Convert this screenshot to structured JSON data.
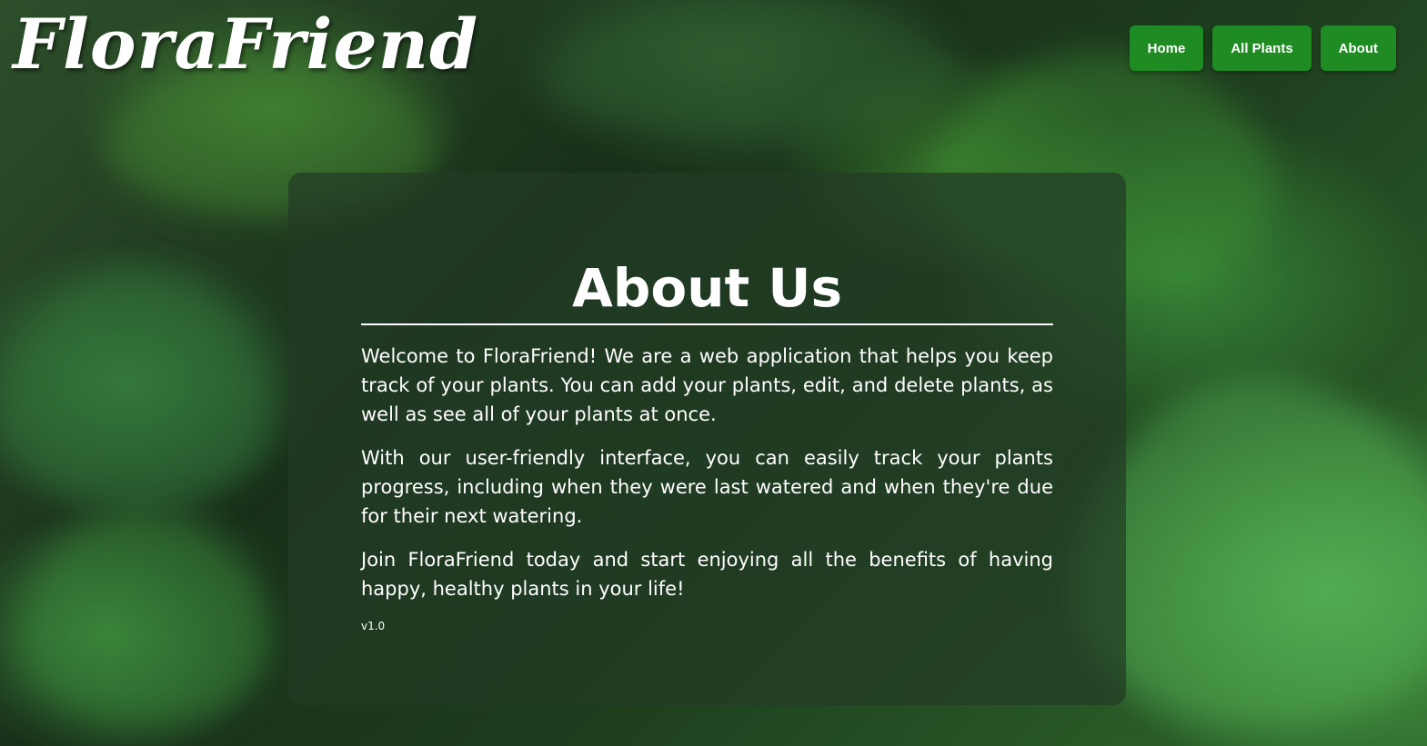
{
  "header": {
    "logo": "FloraFriend",
    "nav": [
      {
        "label": "Home"
      },
      {
        "label": "All Plants"
      },
      {
        "label": "About"
      }
    ],
    "nav_color": "#1f8c23"
  },
  "about": {
    "title": "About Us",
    "paragraphs": [
      "Welcome to FloraFriend! We are a web application that helps you keep track of your plants. You can add your plants, edit, and delete plants, as well as see all of your plants at once.",
      "With our user-friendly interface, you can easily track your plants progress, including when they were last watered and when they're due for their next watering.",
      "Join FloraFriend today and start enjoying all the benefits of having happy, healthy plants in your life!"
    ],
    "version": "v1.0"
  }
}
